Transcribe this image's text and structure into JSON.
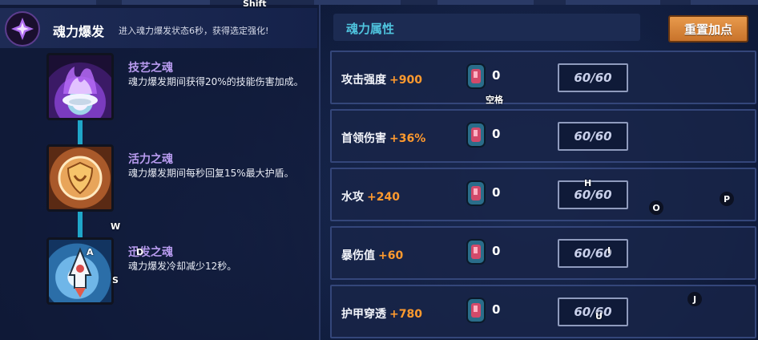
{
  "hints": {
    "shift": "Shift",
    "space": "空格",
    "w": "W",
    "a": "A",
    "s": "S",
    "d": "D",
    "h": "H",
    "o": "O",
    "p": "P",
    "i": "I",
    "j": "J",
    "u": "U"
  },
  "burst": {
    "title": "魂力爆发",
    "desc": "进入魂力爆发状态6秒，获得选定强化!"
  },
  "souls": [
    {
      "name": "技艺之魂",
      "desc": "魂力爆发期间获得20%的技能伤害加成。",
      "icon": "purple-flame-icon"
    },
    {
      "name": "活力之魂",
      "desc": "魂力爆发期间每秒回复15%最大护盾。",
      "icon": "shield-emblem-icon"
    },
    {
      "name": "迅发之魂",
      "desc": "魂力爆发冷却减少12秒。",
      "icon": "rocket-icon"
    }
  ],
  "attributes": {
    "title": "魂力属性",
    "reset_label": "重置加点",
    "rows": [
      {
        "label": "攻击强度",
        "value": "+900",
        "count": "0",
        "cap": "60/60"
      },
      {
        "label": "首领伤害",
        "value": "+36%",
        "count": "0",
        "cap": "60/60"
      },
      {
        "label": "水攻",
        "value": "+240",
        "count": "0",
        "cap": "60/60"
      },
      {
        "label": "暴伤值",
        "value": "+60",
        "count": "0",
        "cap": "60/60"
      },
      {
        "label": "护甲穿透",
        "value": "+780",
        "count": "0",
        "cap": "60/60"
      }
    ]
  },
  "colors": {
    "accent_cyan": "#4fc4de",
    "value_orange": "#ff9a2e",
    "soul_name_purple": "#b99cf0",
    "reset_button": "#d9843a"
  }
}
